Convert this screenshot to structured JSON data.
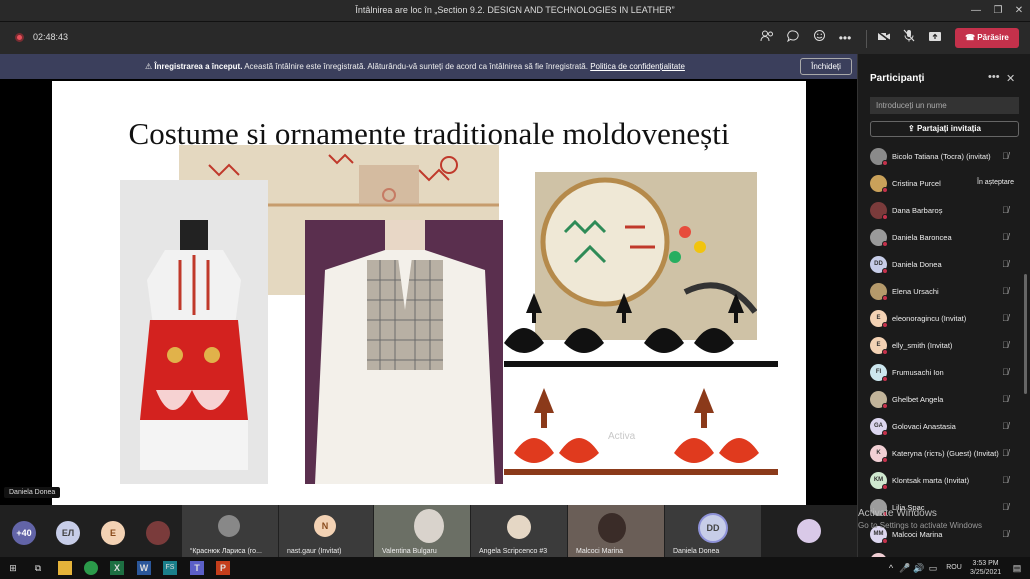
{
  "window": {
    "title": "Întâlnirea are loc în „Section 9.2. DESIGN AND TECHNOLOGIES IN LEATHER”"
  },
  "toolbar": {
    "timer": "02:48:43",
    "leave_label": "Părăsire"
  },
  "banner": {
    "bold": "Înregistrarea a început.",
    "text": " Această întâlnire este înregistrată. Alăturându-vă sunteți de acord ca întâlnirea să fie înregistrată. ",
    "link": "Politica de confidențialitate",
    "dismiss": "Închideți"
  },
  "slide": {
    "title": "Costume și ornamente tradiționale moldovenești",
    "watermark": "Activa"
  },
  "speaker_badge": "Daniela Donea",
  "gallery": {
    "overflow": "+40",
    "avatars": [
      "ЕЛ",
      "E"
    ],
    "tiles": [
      {
        "name": "“Краснюк Лариса (го...",
        "initials": ""
      },
      {
        "name": "nast.gaur (Invitat)",
        "initials": "N"
      },
      {
        "name": "Valentina Bulgaru",
        "initials": ""
      },
      {
        "name": "Angela Scripcenco #3",
        "initials": ""
      },
      {
        "name": "Malcoci Marina",
        "initials": ""
      },
      {
        "name": "Daniela Donea",
        "initials": "DD"
      }
    ]
  },
  "panel": {
    "title": "Participanți",
    "search_placeholder": "Introduceți un nume",
    "share": "Partajați invitația",
    "participants": [
      {
        "initials": "",
        "name": "Bicolo Tatiana (Tocra) (invitat)",
        "color": "#8a8a8a",
        "waiting": ""
      },
      {
        "initials": "",
        "name": "Cristina Purcel",
        "color": "#c9a15a",
        "waiting": "În așteptare"
      },
      {
        "initials": "",
        "name": "Dana Barbaroș",
        "color": "#7a3b3b",
        "waiting": ""
      },
      {
        "initials": "",
        "name": "Daniela Baroncea",
        "color": "#9a9a9a",
        "waiting": ""
      },
      {
        "initials": "DD",
        "name": "Daniela Donea",
        "color": "#c7cde8",
        "waiting": ""
      },
      {
        "initials": "",
        "name": "Elena Ursachi",
        "color": "#b59a6b",
        "waiting": ""
      },
      {
        "initials": "E",
        "name": "eleonoragincu (Invitat)",
        "color": "#f3d2b4",
        "waiting": ""
      },
      {
        "initials": "E",
        "name": "elly_smith (Invitat)",
        "color": "#f3d2b4",
        "waiting": ""
      },
      {
        "initials": "FI",
        "name": "Frumusachi Ion",
        "color": "#cce6ee",
        "waiting": ""
      },
      {
        "initials": "",
        "name": "Ghelbet Angela",
        "color": "#c2b49a",
        "waiting": ""
      },
      {
        "initials": "GA",
        "name": "Golovaci Anastasia",
        "color": "#dcd6ef",
        "waiting": ""
      },
      {
        "initials": "K",
        "name": "Kateryna (гість) (Guest) (Invitat)",
        "color": "#f1cfd4",
        "waiting": ""
      },
      {
        "initials": "KM",
        "name": "Klontsak marta (Invitat)",
        "color": "#cfe8cf",
        "waiting": ""
      },
      {
        "initials": "",
        "name": "Lilia Șpac",
        "color": "#9c9c9c",
        "waiting": ""
      },
      {
        "initials": "MM",
        "name": "Malcoci Marina",
        "color": "#dcd6ef",
        "waiting": ""
      },
      {
        "initials": "MC",
        "name": "Maria Ceban",
        "color": "#f1cfd4",
        "waiting": ""
      }
    ]
  },
  "watermark": {
    "line1": "Activate Windows",
    "line2": "Go to Settings to activate Windows"
  },
  "taskbar": {
    "time": "3:53 PM",
    "date": "3/25/2021",
    "lang": "ROU"
  },
  "colors": {
    "accent": "#c4314b",
    "banner": "#3b3f5c",
    "teams": "#6264a7"
  }
}
